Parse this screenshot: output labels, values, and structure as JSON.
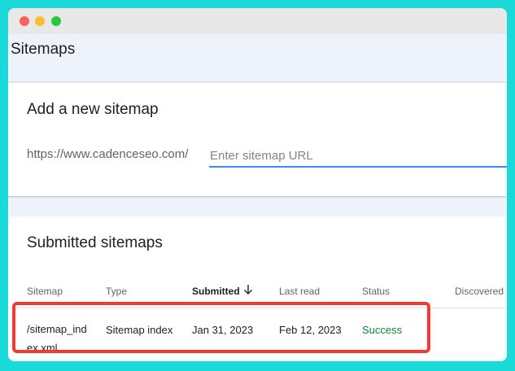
{
  "page": {
    "title": "Sitemaps"
  },
  "add_sitemap": {
    "title": "Add a new sitemap",
    "url_prefix": "https://www.cadenceseo.com/",
    "placeholder": "Enter sitemap URL"
  },
  "submitted": {
    "title": "Submitted sitemaps",
    "columns": {
      "sitemap": "Sitemap",
      "type": "Type",
      "submitted": "Submitted",
      "last_read": "Last read",
      "status": "Status",
      "discovered": "Discovered"
    },
    "sort_icon": "arrow-down-icon",
    "rows": [
      {
        "sitemap": "/sitemap_index.xml",
        "type": "Sitemap index",
        "submitted": "Jan 31, 2023",
        "last_read": "Feb 12, 2023",
        "status": "Success"
      }
    ]
  },
  "colors": {
    "background": "#19d9d9",
    "accent": "#4285f4",
    "success": "#188038",
    "highlight": "#ee3b34"
  }
}
